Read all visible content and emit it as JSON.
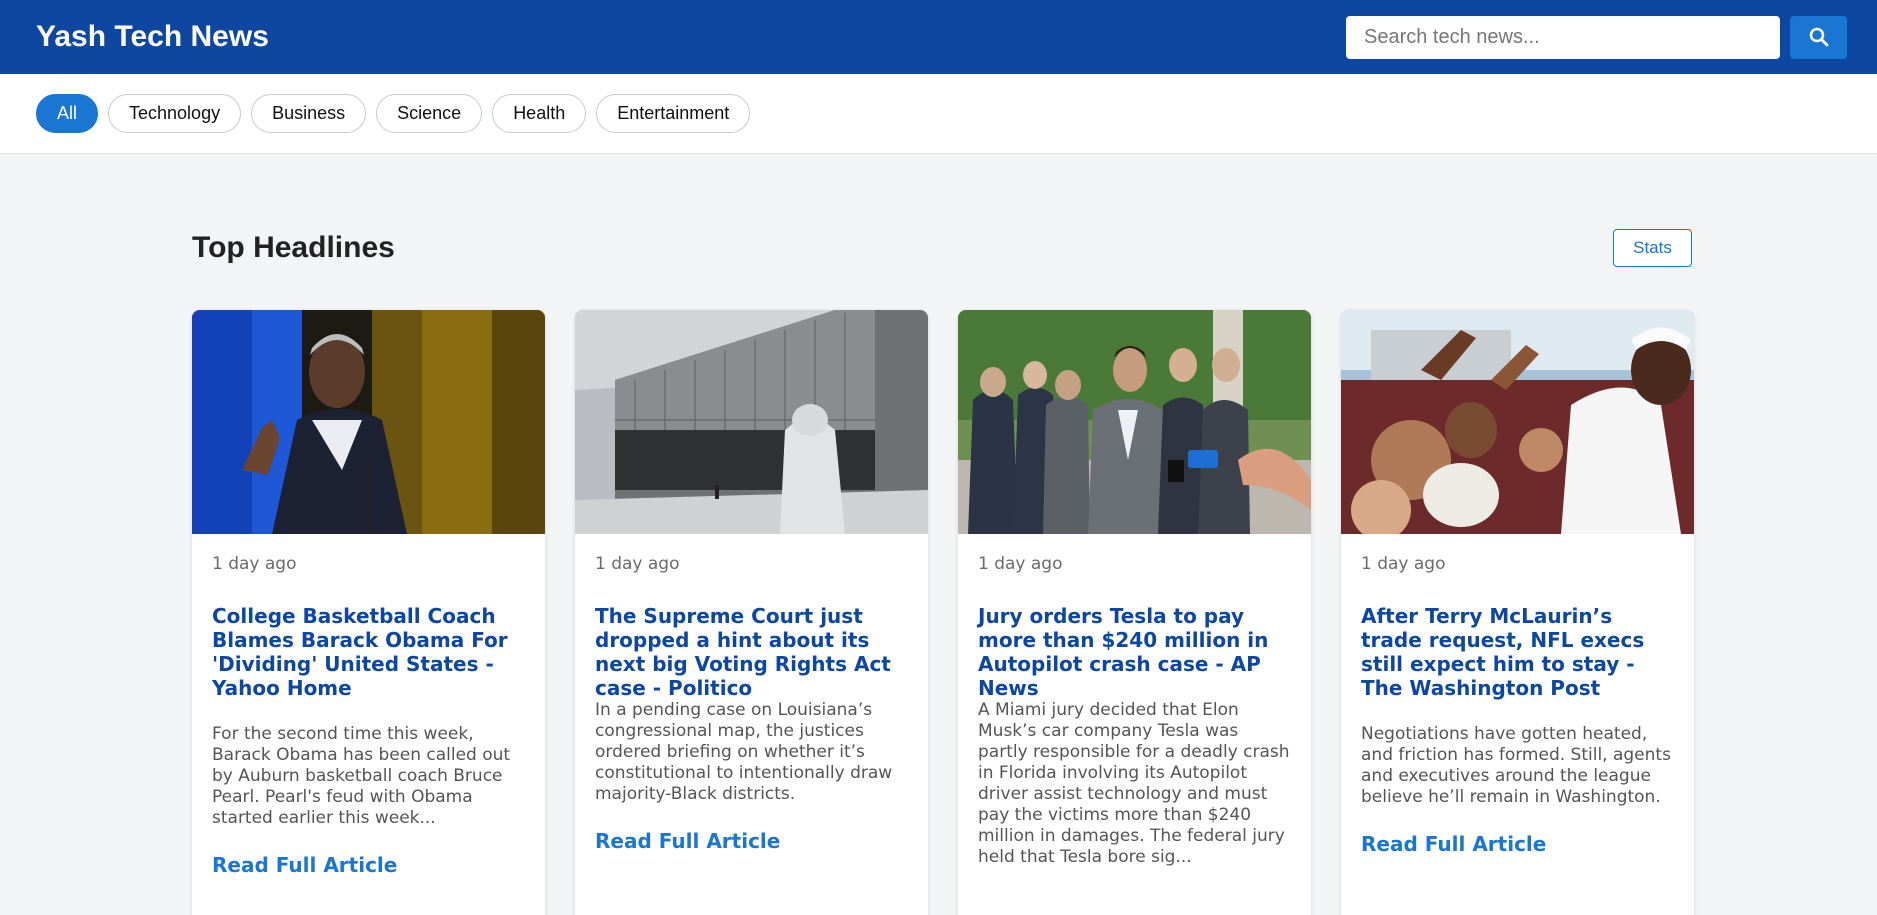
{
  "header": {
    "brand": "Yash Tech News",
    "search_placeholder": "Search tech news..."
  },
  "categories": [
    {
      "label": "All",
      "active": true
    },
    {
      "label": "Technology",
      "active": false
    },
    {
      "label": "Business",
      "active": false
    },
    {
      "label": "Science",
      "active": false
    },
    {
      "label": "Health",
      "active": false
    },
    {
      "label": "Entertainment",
      "active": false
    }
  ],
  "section": {
    "title": "Top Headlines",
    "stats_label": "Stats"
  },
  "articles": [
    {
      "time": "1 day ago",
      "title": "College Basketball Coach Blames Barack Obama For 'Dividing' United States - Yahoo Home",
      "description": "For the second time this week, Barack Obama has been called out by Auburn basketball coach Bruce Pearl. Pearl's feud with Obama started earlier this week...",
      "read_label": "Read Full Article"
    },
    {
      "time": "1 day ago",
      "title": "The Supreme Court just dropped a hint about its next big Voting Rights Act case - Politico",
      "description": "In a pending case on Louisiana’s congressional map, the justices ordered briefing on whether it’s constitutional to intentionally draw majority-Black districts.",
      "read_label": "Read Full Article"
    },
    {
      "time": "1 day ago",
      "title": "Jury orders Tesla to pay more than $240 million in Autopilot crash case - AP News",
      "description": "A Miami jury decided that Elon Musk’s car company Tesla was partly responsible for a deadly crash in Florida involving its Autopilot driver assist technology and must pay the victims more than $240 million in damages. The federal jury held that Tesla bore sig...",
      "read_label": "Read Full Article"
    },
    {
      "time": "1 day ago",
      "title": "After Terry McLaurin’s trade request, NFL execs still expect him to stay - The Washington Post",
      "description": "Negotiations have gotten heated, and friction has formed. Still, agents and executives around the league believe he’ll remain in Washington.",
      "read_label": "Read Full Article"
    }
  ],
  "colors": {
    "header_bg": "#0d47a1",
    "accent": "#1976d2",
    "title_blue": "#0d47a1",
    "page_bg": "#f3f4f6"
  }
}
